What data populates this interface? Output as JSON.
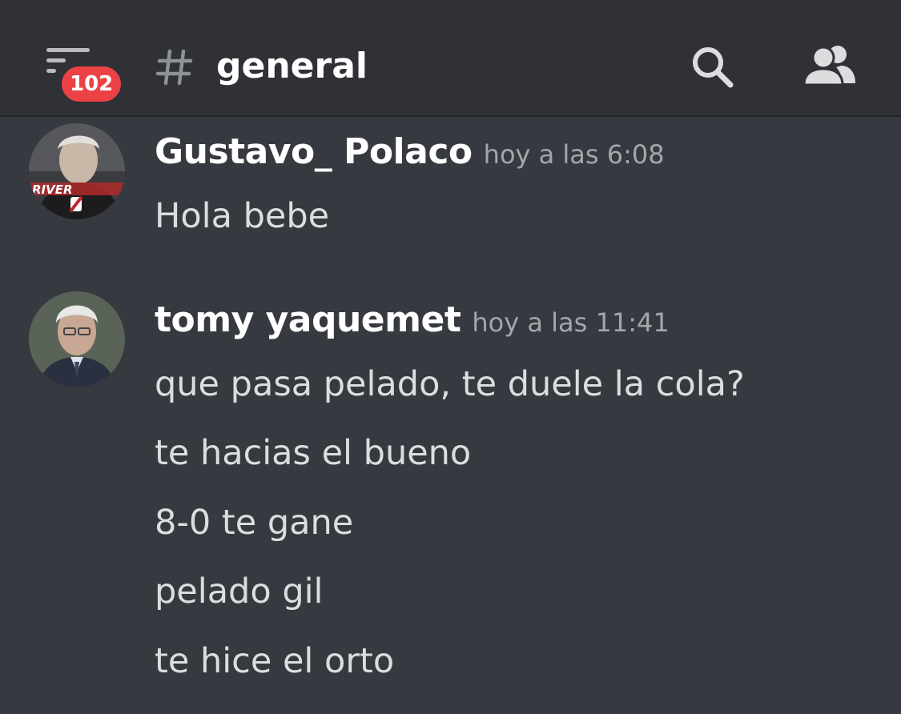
{
  "header": {
    "unread_badge": "102",
    "channel_hash": "#",
    "channel_name": "general"
  },
  "colors": {
    "background": "#36393f",
    "header_background": "#2f3136",
    "badge": "#ed4245",
    "author": "#ffffff",
    "timestamp": "#a3a6aa",
    "message_text": "#dcddde"
  },
  "messages": [
    {
      "author": "Gustavo_ Polaco",
      "timestamp": "hoy a las 6:08",
      "avatar_text": "RIVER",
      "lines": [
        "Hola bebe"
      ]
    },
    {
      "author": "tomy yaquemet",
      "timestamp": "hoy a las 11:41",
      "lines": [
        "que pasa pelado, te duele la cola?",
        "te hacias el bueno",
        "8-0 te gane",
        "pelado gil",
        "te hice el orto"
      ]
    }
  ]
}
